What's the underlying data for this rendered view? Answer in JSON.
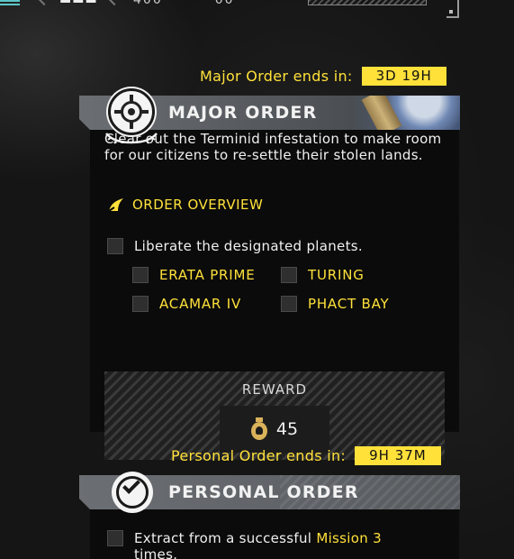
{
  "top_bar": {
    "text_left": "▬▬▬",
    "text_right": "400 · · · · 00"
  },
  "major_order": {
    "ends_label": "Major Order ends in:",
    "ends_value": "3D 19H",
    "title": "MAJOR ORDER",
    "description": "Clear out the Terminid infestation to make room for our citizens to re-settle their stolen lands.",
    "overview_label": "ORDER OVERVIEW",
    "task": "Liberate the designated planets.",
    "planets": [
      "ERATA PRIME",
      "TURING",
      "ACAMAR IV",
      "PHACT BAY"
    ],
    "reward_label": "REWARD",
    "reward_value": "45",
    "reward_icon": "medal-icon"
  },
  "personal_order": {
    "ends_label": "Personal Order ends in:",
    "ends_value": "9H 37M",
    "title": "PERSONAL ORDER",
    "task_prefix": "Extract from a successful ",
    "task_highlight": "Mission 3",
    "task_suffix": "times."
  },
  "colors": {
    "accent_yellow": "#ffe13a",
    "panel_bg": "#0b0b0b",
    "header_gray": "#5c6064"
  }
}
